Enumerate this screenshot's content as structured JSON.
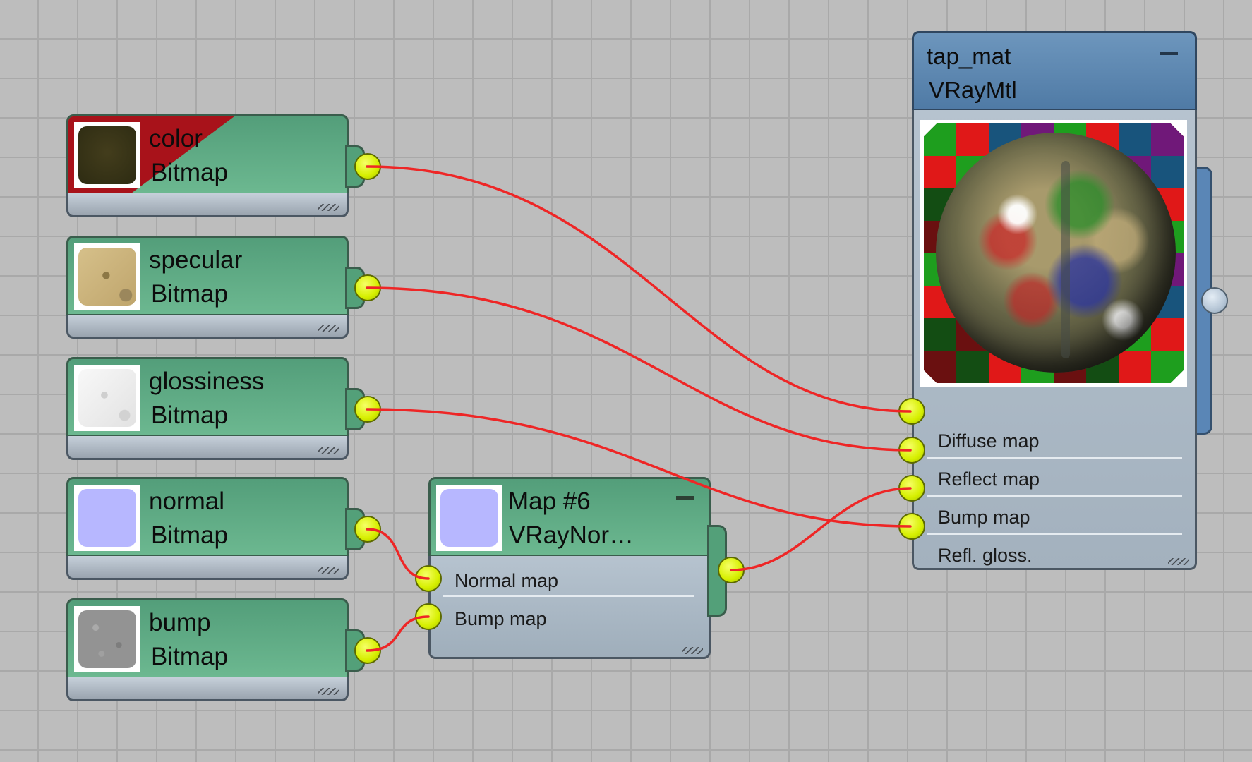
{
  "editor": {
    "bitmap_nodes": [
      {
        "name": "color",
        "type": "Bitmap",
        "selected": true
      },
      {
        "name": "specular",
        "type": "Bitmap",
        "selected": false
      },
      {
        "name": "glossiness",
        "type": "Bitmap",
        "selected": false
      },
      {
        "name": "normal",
        "type": "Bitmap",
        "selected": false
      },
      {
        "name": "bump",
        "type": "Bitmap",
        "selected": false
      }
    ],
    "normal_node": {
      "name": "Map #6",
      "type": "VRayNor…",
      "inputs": [
        "Normal map",
        "Bump map"
      ]
    },
    "material_node": {
      "name": "tap_mat",
      "type": "VRayMtl",
      "inputs": [
        "Diffuse map",
        "Reflect map",
        "Bump map",
        "Refl. gloss."
      ]
    },
    "connections": [
      {
        "from": "color",
        "to": "Diffuse map"
      },
      {
        "from": "specular",
        "to": "Reflect map"
      },
      {
        "from": "glossiness",
        "to": "Refl. gloss."
      },
      {
        "from": "normal",
        "to": "Normal map"
      },
      {
        "from": "bump",
        "to": "Map #6 Bump map"
      },
      {
        "from": "Map #6",
        "to": "Bump map"
      }
    ],
    "colors": {
      "wire": "#ee2626",
      "socket": "#e0f000",
      "map_node": "#5fad85",
      "material_node": "#5f8ab5",
      "selection": "#a8121a"
    }
  }
}
